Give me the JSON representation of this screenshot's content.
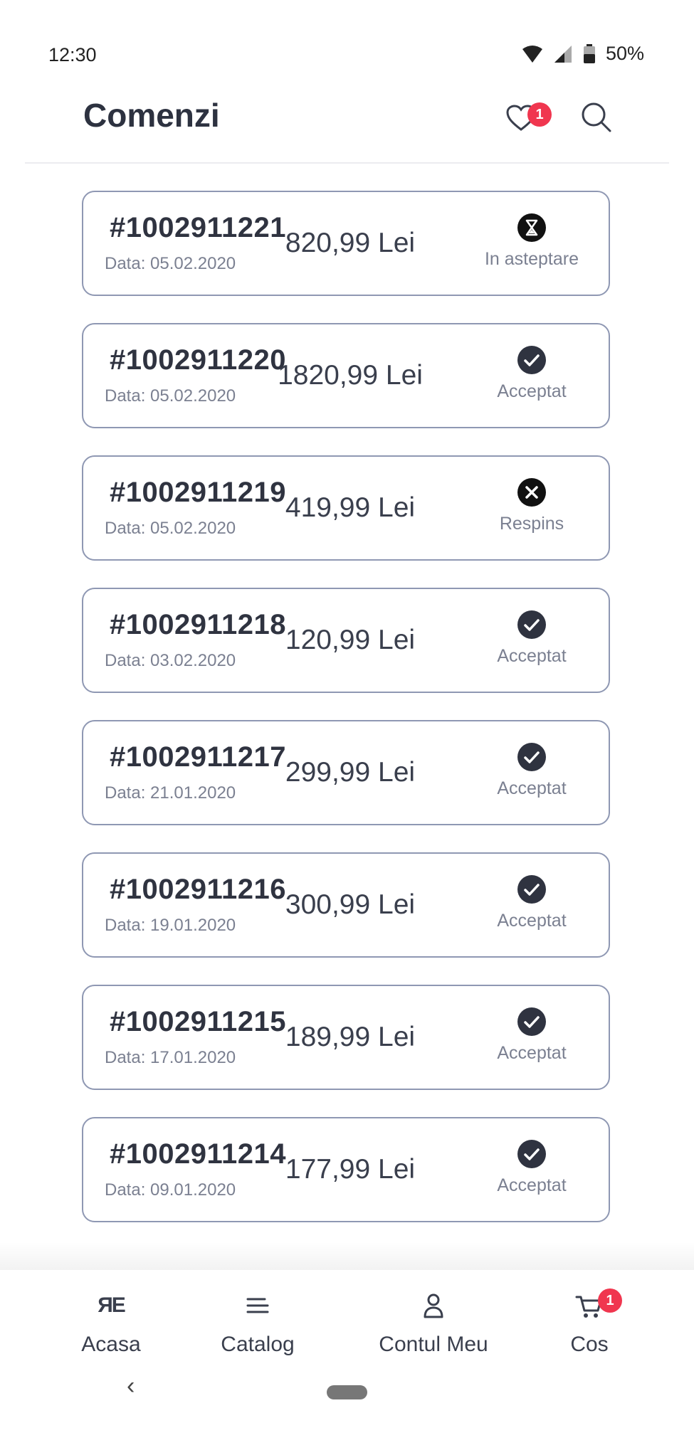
{
  "status_bar": {
    "time": "12:30",
    "battery": "50%",
    "icons": [
      "wifi-icon",
      "signal-icon",
      "battery-icon"
    ]
  },
  "header": {
    "title": "Comenzi",
    "favorites_count": "1",
    "icons": [
      "heart-icon",
      "search-icon"
    ]
  },
  "orders": [
    {
      "number": "#1002911221",
      "date": "Data: 05.02.2020",
      "total": "820,99 Lei",
      "status": "In asteptare",
      "status_icon": "hourglass-icon"
    },
    {
      "number": "#1002911220",
      "date": "Data: 05.02.2020",
      "total": "1820,99 Lei",
      "status": "Acceptat",
      "status_icon": "check-icon"
    },
    {
      "number": "#1002911219",
      "date": "Data: 05.02.2020",
      "total": "419,99 Lei",
      "status": "Respins",
      "status_icon": "close-icon"
    },
    {
      "number": "#1002911218",
      "date": "Data: 03.02.2020",
      "total": "120,99 Lei",
      "status": "Acceptat",
      "status_icon": "check-icon"
    },
    {
      "number": "#1002911217",
      "date": "Data: 21.01.2020",
      "total": "299,99 Lei",
      "status": "Acceptat",
      "status_icon": "check-icon"
    },
    {
      "number": "#1002911216",
      "date": "Data: 19.01.2020",
      "total": "300,99 Lei",
      "status": "Acceptat",
      "status_icon": "check-icon"
    },
    {
      "number": "#1002911215",
      "date": "Data: 17.01.2020",
      "total": "189,99 Lei",
      "status": "Acceptat",
      "status_icon": "check-icon"
    },
    {
      "number": "#1002911214",
      "date": "Data: 09.01.2020",
      "total": "177,99 Lei",
      "status": "Acceptat",
      "status_icon": "check-icon"
    }
  ],
  "bottom_nav": {
    "acasa": {
      "label": "Acasa",
      "icon": "home-logo-icon",
      "logo_text": "ЯE"
    },
    "catalog": {
      "label": "Catalog",
      "icon": "menu-icon"
    },
    "contul_meu": {
      "label": "Contul Meu",
      "icon": "user-icon"
    },
    "cos": {
      "label": "Cos",
      "icon": "cart-icon",
      "badge": "1"
    }
  },
  "system_nav": {
    "back_symbol": "‹"
  },
  "colors": {
    "accent": "#f0364f",
    "text": "#2f3340",
    "muted": "#7b8091",
    "card_border": "#8f98b3"
  }
}
